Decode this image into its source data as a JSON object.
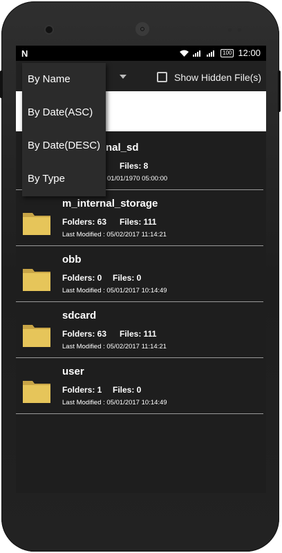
{
  "status_bar": {
    "notification_letter": "N",
    "battery": "100",
    "time": "12:00"
  },
  "toolbar": {
    "show_hidden_label": "Show Hidden File(s)",
    "show_hidden_checked": false
  },
  "sort_menu": {
    "items": [
      "By Name",
      "By Date(ASC)",
      "By Date(DESC)",
      "By Type"
    ]
  },
  "files": [
    {
      "name": "nal_sd",
      "folders": "",
      "files": "Files: 8",
      "modified": "01/01/1970 05:00:00"
    },
    {
      "name": "m_internal_storage",
      "folders": "Folders: 63",
      "files": "Files: 111",
      "modified": "Last Modified : 05/02/2017 11:14:21"
    },
    {
      "name": "obb",
      "folders": "Folders: 0",
      "files": "Files: 0",
      "modified": "Last Modified : 05/01/2017 10:14:49"
    },
    {
      "name": "sdcard",
      "folders": "Folders: 63",
      "files": "Files: 111",
      "modified": "Last Modified : 05/02/2017 11:14:21"
    },
    {
      "name": "user",
      "folders": "Folders: 1",
      "files": "Files: 0",
      "modified": "Last Modified : 05/01/2017 10:14:49"
    }
  ],
  "colors": {
    "screen_bg": "#1e1e1e",
    "folder_yellow": "#e6c55a",
    "menu_bg": "#2b2b2b"
  }
}
